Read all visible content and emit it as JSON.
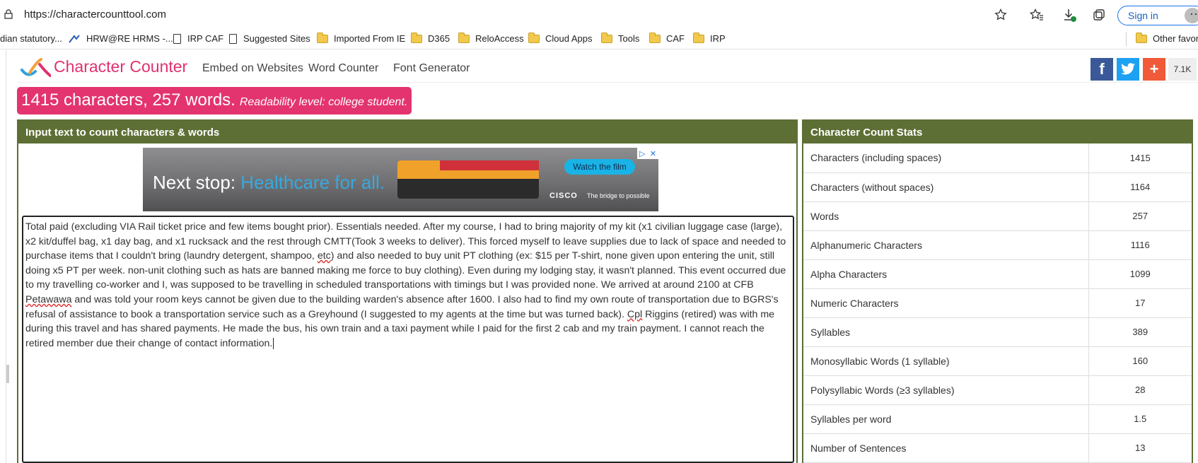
{
  "browser": {
    "url": "https://charactercounttool.com",
    "sign_in_label": "Sign in",
    "bookmarks": [
      {
        "label": "dian statutory...",
        "icon": "none"
      },
      {
        "label": "HRW@RE HRMS -...",
        "icon": "hrms-icon"
      },
      {
        "label": "IRP CAF",
        "icon": "page-icon"
      },
      {
        "label": "Suggested Sites",
        "icon": "page-icon"
      },
      {
        "label": "Imported From IE",
        "icon": "folder-icon"
      },
      {
        "label": "D365",
        "icon": "folder-icon"
      },
      {
        "label": "ReloAccess",
        "icon": "folder-icon"
      },
      {
        "label": "Cloud Apps",
        "icon": "folder-icon"
      },
      {
        "label": "Tools",
        "icon": "folder-icon"
      },
      {
        "label": "CAF",
        "icon": "folder-icon"
      },
      {
        "label": "IRP",
        "icon": "folder-icon"
      }
    ],
    "other_favorites": "Other favorit"
  },
  "site": {
    "brand": "Character Counter",
    "nav": [
      "Embed on Websites",
      "Word Counter",
      "Font Generator"
    ],
    "share_count": "7.1K",
    "colors": {
      "brand": "#e0316f",
      "panel": "#5e6f35",
      "facebook": "#3b5998",
      "twitter": "#1da1f2",
      "add": "#f05a38"
    }
  },
  "summary": {
    "main": "1415 characters, 257 words.",
    "readability": "Readability level: college student."
  },
  "input_panel": {
    "title": "Input text to count characters & words",
    "ad": {
      "headline_a": "Next stop:",
      "headline_b": "Healthcare for all.",
      "cta": "Watch the film",
      "brand": "CISCO",
      "tagline": "The bridge to possible"
    },
    "text_parts": [
      "Total paid (excluding VIA Rail ticket price and few items bought prior). Essentials needed. After my course, I had to bring majority of my kit (x1 civilian luggage case (large), x2 kit/duffel bag, x1 day bag, and x1 rucksack and the rest through CMTT(Took 3 weeks to deliver). This forced myself to leave supplies due to lack of space and needed to purchase items that I couldn't bring (laundry detergent, shampoo, ",
      "etc",
      ") and also needed to buy unit PT clothing (ex: $15 per T-shirt, none given upon entering the unit, still doing x5 PT per week. non-unit clothing such as hats are banned making me force to buy clothing). Even during my lodging stay, it wasn't planned. This event occurred due to my travelling co-worker and I, was supposed to be travelling in scheduled transportations with timings but I was provided none. We arrived at around 2100 at CFB ",
      "Petawawa",
      " and was told your room keys cannot be given due to the building warden's absence after 1600. I also had to find my own route of transportation due to BGRS's refusal of assistance to book a transportation service such as a Greyhound (I suggested to my agents at the time but was turned back). ",
      "Cpl",
      " Riggins (retired) was with me during this travel and has shared payments. He made the bus, his own train and a taxi payment while I paid for the first 2 cab and my train payment. I cannot reach the retired member due their change of contact information."
    ]
  },
  "stats_panel": {
    "title": "Character Count Stats",
    "rows": [
      {
        "label": "Characters (including spaces)",
        "value": "1415"
      },
      {
        "label": "Characters (without spaces)",
        "value": "1164"
      },
      {
        "label": "Words",
        "value": "257"
      },
      {
        "label": "Alphanumeric Characters",
        "value": "1116"
      },
      {
        "label": "Alpha Characters",
        "value": "1099"
      },
      {
        "label": "Numeric Characters",
        "value": "17"
      },
      {
        "label": "Syllables",
        "value": "389"
      },
      {
        "label": "Monosyllabic Words (1 syllable)",
        "value": "160"
      },
      {
        "label": "Polysyllabic Words (≥3 syllables)",
        "value": "28"
      },
      {
        "label": "Syllables per word",
        "value": "1.5"
      },
      {
        "label": "Number of Sentences",
        "value": "13"
      }
    ]
  }
}
